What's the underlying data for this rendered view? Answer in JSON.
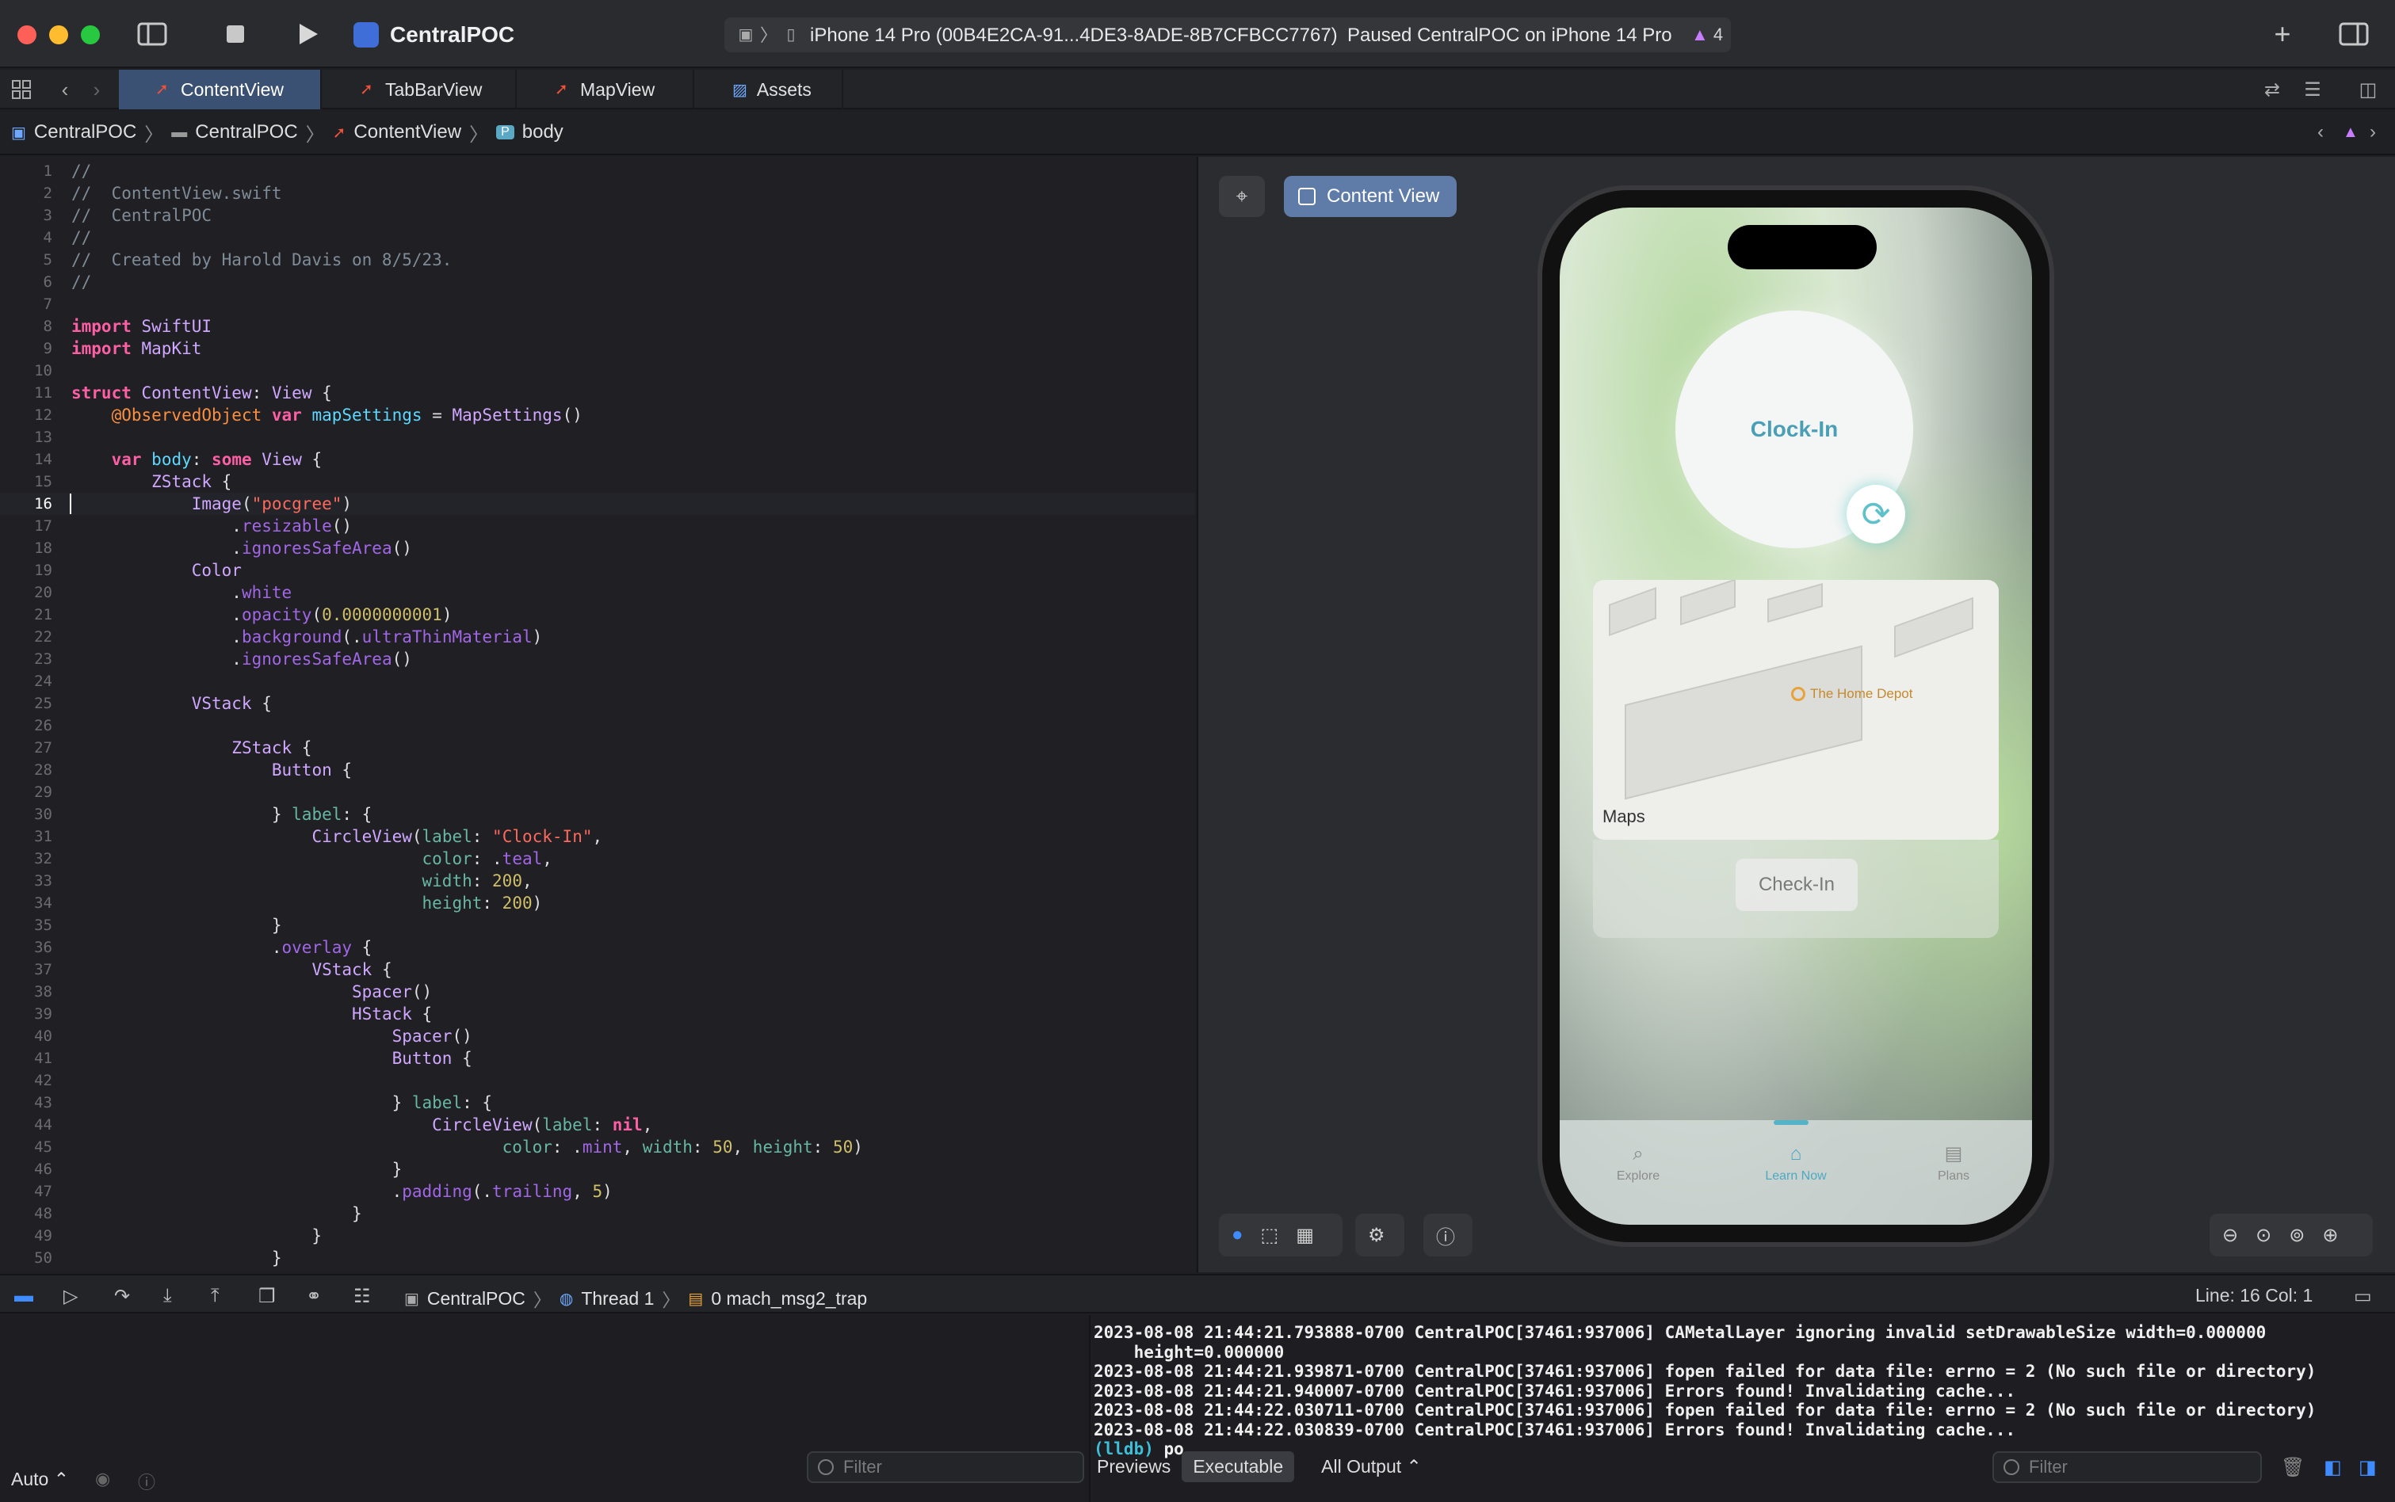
{
  "window": {
    "app_name": "CentralPOC",
    "scheme_device": "iPhone 14 Pro (00B4E2CA-91...4DE3-8ADE-8B7CFBCC7767)",
    "scheme_status": "Paused CentralPOC on iPhone 14 Pro",
    "warning_count": "4"
  },
  "tabs": [
    {
      "label": "ContentView"
    },
    {
      "label": "TabBarView"
    },
    {
      "label": "MapView"
    },
    {
      "label": "Assets"
    }
  ],
  "breadcrumb": [
    "CentralPOC",
    "CentralPOC",
    "ContentView",
    "body"
  ],
  "code_lines": [
    "//",
    "//  ContentView.swift",
    "//  CentralPOC",
    "//",
    "//  Created by Harold Davis on 8/5/23.",
    "//",
    "",
    "import SwiftUI",
    "import MapKit",
    "",
    "struct ContentView: View {",
    "    @ObservedObject var mapSettings = MapSettings()",
    "",
    "    var body: some View {",
    "        ZStack {",
    "            Image(\"pocgree\")",
    "                .resizable()",
    "                .ignoresSafeArea()",
    "            Color",
    "                .white",
    "                .opacity(0.0000000001)",
    "                .background(.ultraThinMaterial)",
    "                .ignoresSafeArea()",
    "",
    "            VStack {",
    "",
    "                ZStack {",
    "                    Button {",
    "",
    "                    } label: {",
    "                        CircleView(label: \"Clock-In\",",
    "                                   color: .teal,",
    "                                   width: 200,",
    "                                   height: 200)",
    "                    }",
    "                    .overlay {",
    "                        VStack {",
    "                            Spacer()",
    "                            HStack {",
    "                                Spacer()",
    "                                Button {",
    "",
    "                                } label: {",
    "                                    CircleView(label: nil,",
    "                                           color: .mint, width: 50, height: 50)",
    "                                }",
    "                                .padding(.trailing, 5)",
    "                            }",
    "                        }",
    "                    }"
  ],
  "current_line": 16,
  "canvas": {
    "chip_label": "Content View",
    "clock_label": "Clock-In",
    "store_label": "The Home Depot",
    "maps_label": "Maps",
    "checkin_label": "Check-In",
    "tabs": [
      {
        "label": "Explore",
        "icon": "magnifier-icon"
      },
      {
        "label": "Learn Now",
        "icon": "house-icon"
      },
      {
        "label": "Plans",
        "icon": "stack-icon"
      }
    ]
  },
  "debug": {
    "project": "CentralPOC",
    "thread": "Thread 1",
    "frame": "0 mach_msg2_trap",
    "line_col": "Line: 16  Col: 1"
  },
  "console": {
    "lines": [
      "2023-08-08 21:44:21.793888-0700 CentralPOC[37461:937006] CAMetalLayer ignoring invalid setDrawableSize width=0.000000",
      "    height=0.000000",
      "2023-08-08 21:44:21.939871-0700 CentralPOC[37461:937006] fopen failed for data file: errno = 2 (No such file or directory)",
      "2023-08-08 21:44:21.940007-0700 CentralPOC[37461:937006] Errors found! Invalidating cache...",
      "2023-08-08 21:44:22.030711-0700 CentralPOC[37461:937006] fopen failed for data file: errno = 2 (No such file or directory)",
      "2023-08-08 21:44:22.030839-0700 CentralPOC[37461:937006] Errors found! Invalidating cache..."
    ],
    "prompt": "(lldb)",
    "input": "po"
  },
  "bottom": {
    "auto_label": "Auto",
    "filter_placeholder": "Filter",
    "previews_label": "Previews",
    "executable_label": "Executable",
    "all_output_label": "All Output"
  }
}
